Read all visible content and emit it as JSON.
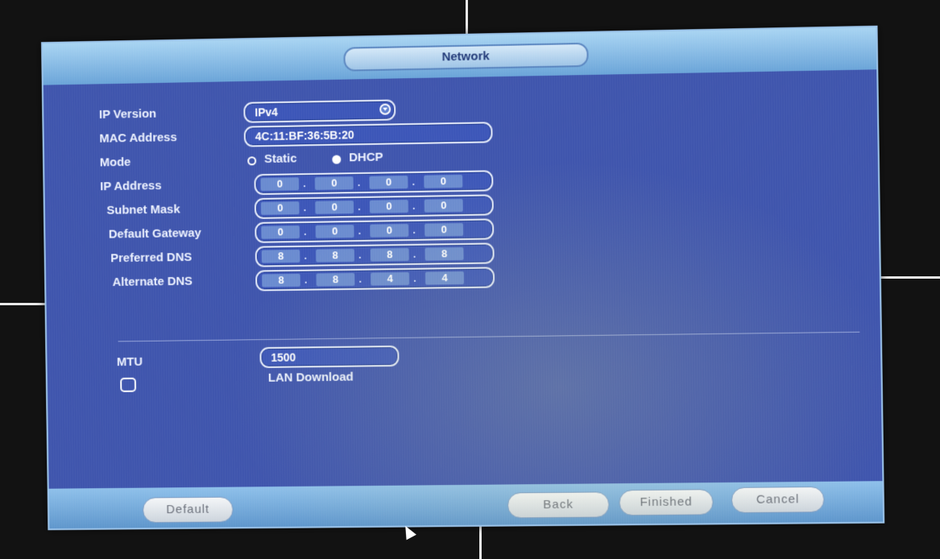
{
  "window": {
    "title": "Network"
  },
  "form": {
    "ip_version": {
      "label": "IP Version",
      "value": "IPv4"
    },
    "mac_address": {
      "label": "MAC Address",
      "value": "4C:11:BF:36:5B:20"
    },
    "mode": {
      "label": "Mode",
      "options": [
        "Static",
        "DHCP"
      ],
      "selected": "DHCP"
    },
    "ip_address": {
      "label": "IP Address",
      "octets": [
        "0",
        "0",
        "0",
        "0"
      ]
    },
    "subnet_mask": {
      "label": "Subnet Mask",
      "octets": [
        "0",
        "0",
        "0",
        "0"
      ]
    },
    "default_gateway": {
      "label": "Default Gateway",
      "octets": [
        "0",
        "0",
        "0",
        "0"
      ]
    },
    "preferred_dns": {
      "label": "Preferred DNS",
      "octets": [
        "8",
        "8",
        "8",
        "8"
      ]
    },
    "alternate_dns": {
      "label": "Alternate DNS",
      "octets": [
        "8",
        "8",
        "4",
        "4"
      ]
    },
    "mtu": {
      "label": "MTU",
      "value": "1500"
    },
    "lan_download": {
      "label": "LAN Download",
      "checked": false
    }
  },
  "buttons": {
    "default": "Default",
    "back": "Back",
    "finished": "Finished",
    "cancel": "Cancel"
  },
  "icons": {
    "dropdown": "chevron-down-icon",
    "cursor": "mouse-cursor-icon"
  },
  "colors": {
    "panel": "#3f55ad",
    "title_bar": "#8ec0ea",
    "button": "#e6eaee"
  }
}
